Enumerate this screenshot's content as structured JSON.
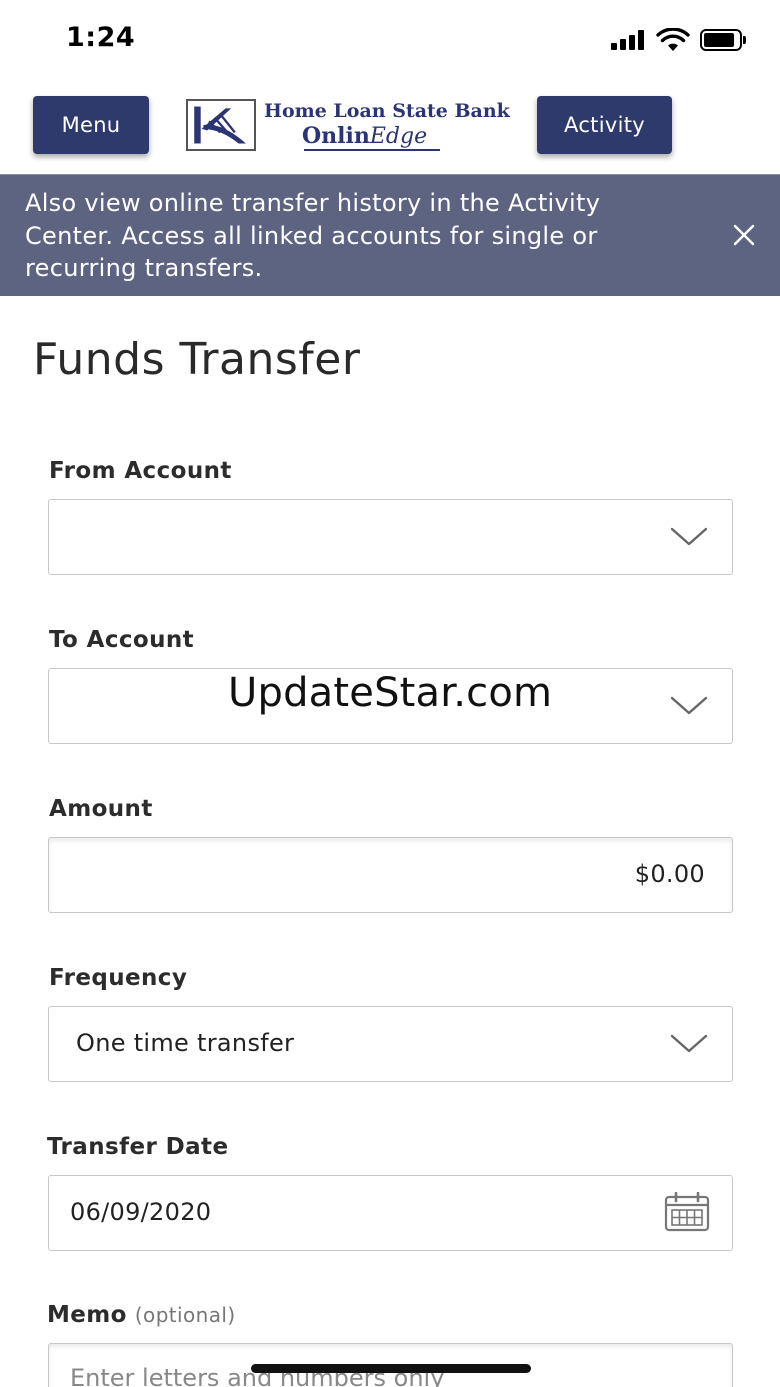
{
  "status_bar": {
    "time": "1:24"
  },
  "header": {
    "menu_label": "Menu",
    "activity_label": "Activity",
    "logo": {
      "line1": "Home Loan State Bank",
      "line2_plain": "Onlin",
      "line2_italic": "Edge"
    }
  },
  "banner": {
    "text": "Also view online transfer history in the Activity Center. Access all linked accounts for single or recurring transfers."
  },
  "page": {
    "title": "Funds Transfer"
  },
  "form": {
    "from_account": {
      "label": "From Account",
      "value": ""
    },
    "to_account": {
      "label": "To Account",
      "value": ""
    },
    "amount": {
      "label": "Amount",
      "value": "$0.00"
    },
    "frequency": {
      "label": "Frequency",
      "value": "One time transfer"
    },
    "transfer_date": {
      "label": "Transfer Date",
      "value": "06/09/2020"
    },
    "memo": {
      "label": "Memo",
      "optional_note": "(optional)",
      "placeholder": "Enter letters and numbers only"
    }
  },
  "watermark": "UpdateStar.com",
  "icons": {
    "close": "close-icon",
    "chevron": "chevron-down-icon",
    "calendar": "calendar-icon"
  },
  "colors": {
    "header_button": "#2e3a6b",
    "banner_bg": "#5c6482",
    "brand_text": "#2b3573"
  }
}
